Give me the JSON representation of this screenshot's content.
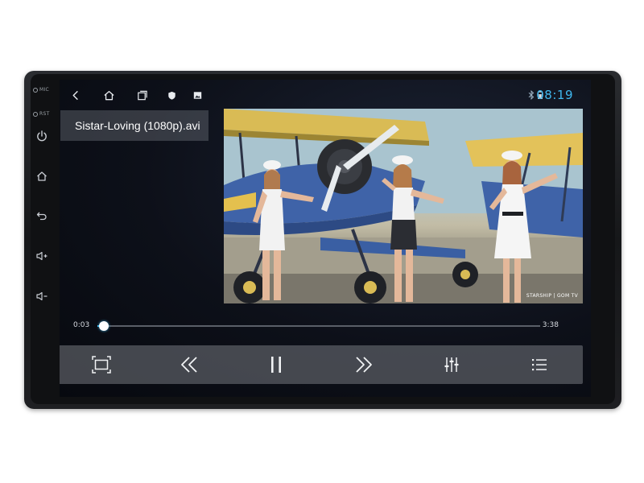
{
  "side_panel": {
    "mic_label": "MIC",
    "rst_label": "RST",
    "buttons": [
      "power-icon",
      "home-icon",
      "back-icon",
      "volume-up-icon",
      "volume-down-icon"
    ]
  },
  "status_bar": {
    "nav_icons": [
      "back-icon",
      "home-icon",
      "recents-icon",
      "shield-icon",
      "image-icon"
    ],
    "time": "08:19",
    "indicators": [
      "bluetooth-icon",
      "battery-icon"
    ],
    "accent_color": "#3fb8ef"
  },
  "player": {
    "file_name": "Sistar-Loving (1080p).avi",
    "watermark": "STARSHIP | GOM TV",
    "current_time": "0:03",
    "total_time": "3:38",
    "progress_fraction": 0.014
  },
  "controls": {
    "buttons": [
      "aspect-ratio-icon",
      "rewind-icon",
      "pause-icon",
      "fast-forward-icon",
      "equalizer-icon",
      "playlist-icon"
    ]
  }
}
